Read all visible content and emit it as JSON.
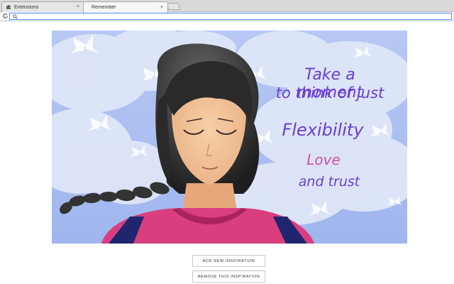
{
  "browser": {
    "tabs": [
      {
        "label": "Extensions",
        "icon": "puzzle-icon",
        "active": false
      },
      {
        "label": "Remember",
        "icon": "none",
        "active": true
      }
    ],
    "close_glyph": "×",
    "address_bar": {
      "value": "",
      "placeholder": ""
    }
  },
  "inspiration": {
    "lines": [
      "Take a moment",
      "to think of just",
      "Flexibility",
      "Love",
      "and trust"
    ],
    "colors": {
      "text": "#6a3fd0",
      "love": "#d44fa3",
      "sky": "#a9bdf0",
      "cloud": "#dfe6f8"
    }
  },
  "actions": {
    "add_label": "ADD NEW INSPIRATION",
    "remove_label": "REMOVE THIS INSPIRATION"
  }
}
